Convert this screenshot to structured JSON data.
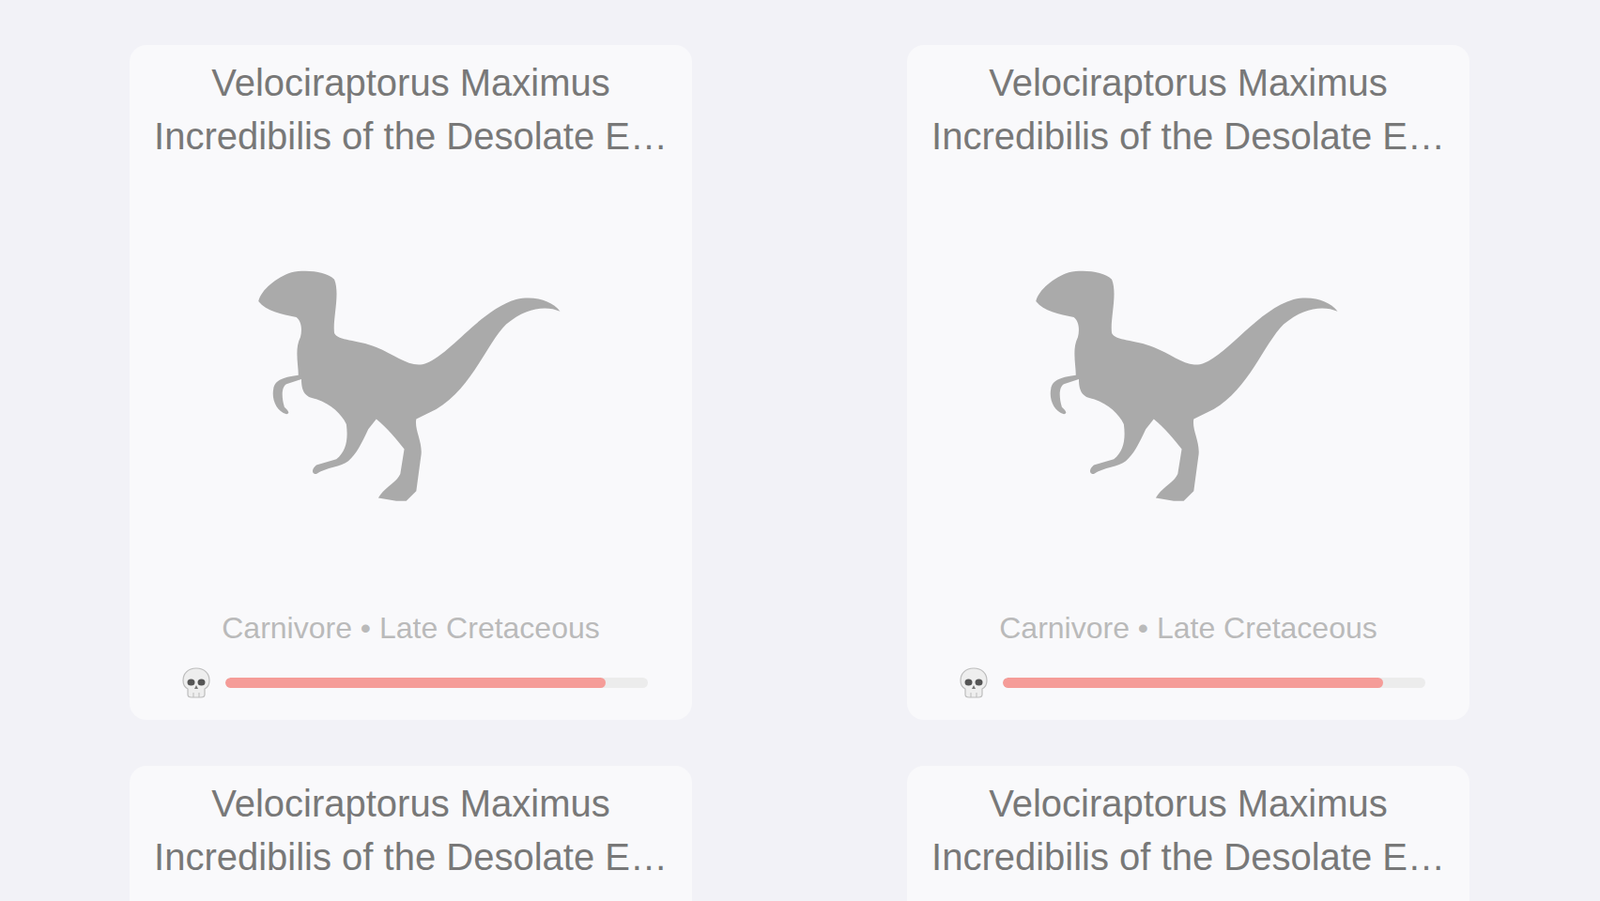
{
  "cards": [
    {
      "title": "Velociraptorus Maximus Incredibilis of the Desolate E…",
      "meta": "Carnivore • Late Cretaceous",
      "level": 0.9
    },
    {
      "title": "Velociraptorus Maximus Incredibilis of the Desolate E…",
      "meta": "Carnivore • Late Cretaceous",
      "level": 0.9
    },
    {
      "title": "Velociraptorus Maximus Incredibilis of the Desolate E…"
    },
    {
      "title": "Velociraptorus Maximus Incredibilis of the Desolate E…"
    }
  ]
}
